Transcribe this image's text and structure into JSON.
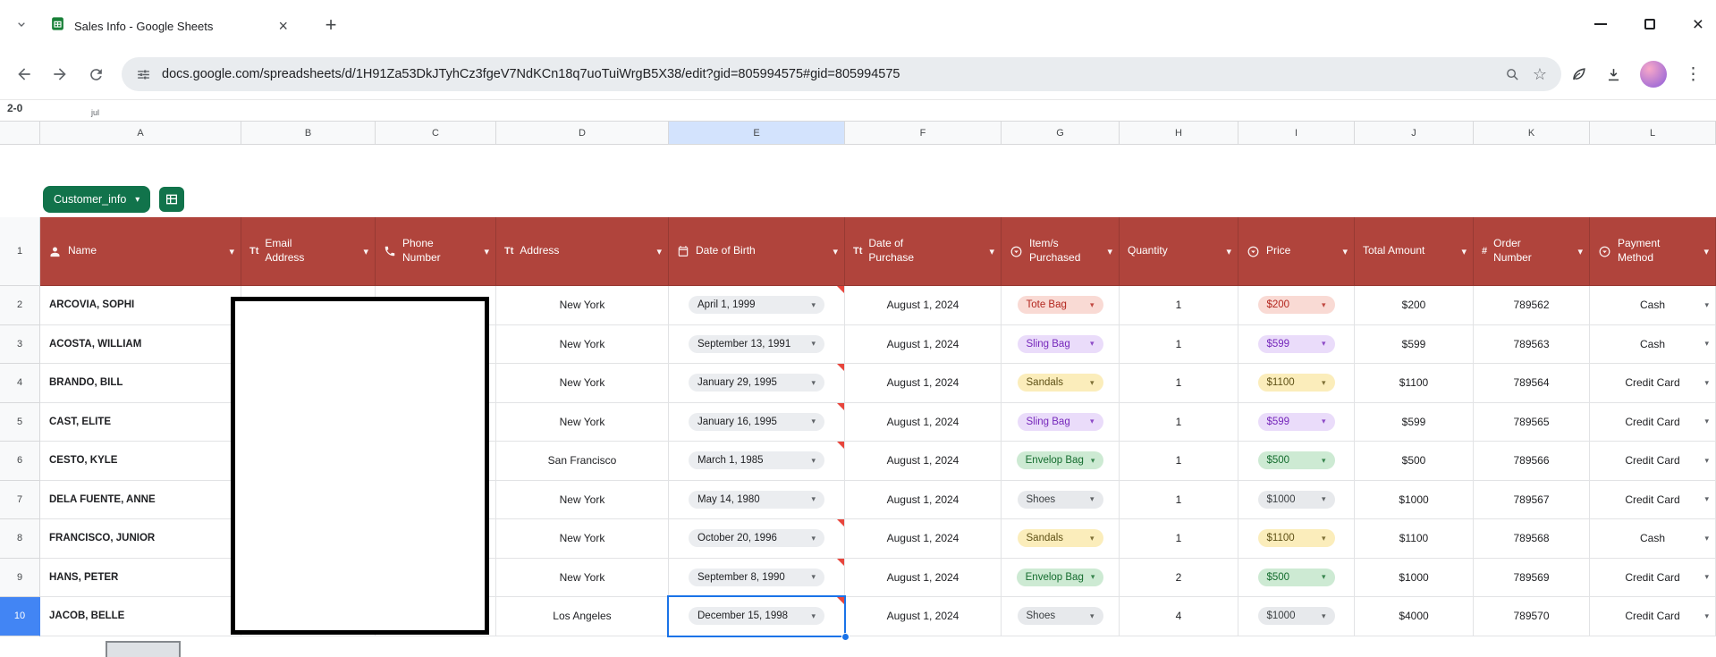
{
  "browser": {
    "tab_title": "Sales Info - Google Sheets",
    "url": "docs.google.com/spreadsheets/d/1H91Za53DkJTyhCz3fgeV7NdKCn18q7uoTuiWrgB5X38/edit?gid=805994575#gid=805994575"
  },
  "icons": {
    "new_tab": "+",
    "close": "×",
    "minimize": "—",
    "menu_dots": "⋮",
    "chevron_down": "▾",
    "star": "☆"
  },
  "colors": {
    "header_red": "#B0443C",
    "table_chip_green": "#11734B",
    "selection_blue": "#1A73E8",
    "selected_row_header": "#4285F4",
    "selected_col_header": "#D3E3FD",
    "flag_red": "#E8453C"
  },
  "sheet": {
    "table_name": "Customer_info",
    "formula_fragments": {
      "left": "2-0",
      "mid": "jul"
    },
    "column_letters": [
      "A",
      "B",
      "C",
      "D",
      "E",
      "F",
      "G",
      "H",
      "I",
      "J",
      "K",
      "L"
    ],
    "selected_column": "E",
    "selected_row": 10,
    "selected_cell": "E10",
    "headers": [
      {
        "col": "A",
        "label": "Name",
        "icon": "person-icon"
      },
      {
        "col": "B",
        "label": "Email Address",
        "icon": "text-icon"
      },
      {
        "col": "C",
        "label": "Phone Number",
        "icon": "phone-icon"
      },
      {
        "col": "D",
        "label": "Address",
        "icon": "text-icon"
      },
      {
        "col": "E",
        "label": "Date of Birth",
        "icon": "calendar-icon"
      },
      {
        "col": "F",
        "label": "Date of Purchase",
        "icon": "text-icon"
      },
      {
        "col": "G",
        "label": "Item/s Purchased",
        "icon": "dropdown-icon"
      },
      {
        "col": "H",
        "label": "Quantity",
        "icon": "none"
      },
      {
        "col": "I",
        "label": "Price",
        "icon": "dropdown-icon"
      },
      {
        "col": "J",
        "label": "Total Amount",
        "icon": "none"
      },
      {
        "col": "K",
        "label": "Order Number",
        "icon": "hash-icon"
      },
      {
        "col": "L",
        "label": "Payment Method",
        "icon": "dropdown-icon"
      }
    ],
    "chip_colors": {
      "red": {
        "bg": "#F9DAD4",
        "fg": "#B3261E"
      },
      "purple": {
        "bg": "#EADCFA",
        "fg": "#7627BB"
      },
      "yellow": {
        "bg": "#FBEDBB",
        "fg": "#5F5116"
      },
      "green": {
        "bg": "#CDEAD3",
        "fg": "#146C2E"
      },
      "gray": {
        "bg": "#E7E9EC",
        "fg": "#3C4043"
      },
      "date": {
        "bg": "#EBEDF0",
        "fg": "#202124"
      }
    },
    "rows": [
      {
        "row": 2,
        "name": "ARCOVIA, SOPHI",
        "address": "New York",
        "dob": "April 1, 1999",
        "dob_flag": true,
        "purchase_date": "August 1, 2024",
        "item": "Tote Bag",
        "item_color": "red",
        "quantity": "1",
        "price": "$200",
        "price_color": "red",
        "total": "$200",
        "order": "789562",
        "payment": "Cash"
      },
      {
        "row": 3,
        "name": "ACOSTA, WILLIAM",
        "address": "New York",
        "dob": "September 13, 1991",
        "dob_flag": false,
        "purchase_date": "August 1, 2024",
        "item": "Sling Bag",
        "item_color": "purple",
        "quantity": "1",
        "price": "$599",
        "price_color": "purple",
        "total": "$599",
        "order": "789563",
        "payment": "Cash"
      },
      {
        "row": 4,
        "name": "BRANDO, BILL",
        "address": "New York",
        "dob": "January 29, 1995",
        "dob_flag": true,
        "purchase_date": "August 1, 2024",
        "item": "Sandals",
        "item_color": "yellow",
        "quantity": "1",
        "price": "$1100",
        "price_color": "yellow",
        "total": "$1100",
        "order": "789564",
        "payment": "Credit Card"
      },
      {
        "row": 5,
        "name": "CAST, ELITE",
        "address": "New York",
        "dob": "January 16, 1995",
        "dob_flag": true,
        "purchase_date": "August 1, 2024",
        "item": "Sling Bag",
        "item_color": "purple",
        "quantity": "1",
        "price": "$599",
        "price_color": "purple",
        "total": "$599",
        "order": "789565",
        "payment": "Credit Card"
      },
      {
        "row": 6,
        "name": "CESTO, KYLE",
        "address": "San Francisco",
        "dob": "March 1, 1985",
        "dob_flag": true,
        "purchase_date": "August 1, 2024",
        "item": "Envelop Bag",
        "item_color": "green",
        "quantity": "1",
        "price": "$500",
        "price_color": "green",
        "total": "$500",
        "order": "789566",
        "payment": "Credit Card"
      },
      {
        "row": 7,
        "name": "DELA FUENTE, ANNE",
        "address": "New York",
        "dob": "May 14, 1980",
        "dob_flag": false,
        "purchase_date": "August 1, 2024",
        "item": "Shoes",
        "item_color": "gray",
        "quantity": "1",
        "price": "$1000",
        "price_color": "gray",
        "total": "$1000",
        "order": "789567",
        "payment": "Credit Card"
      },
      {
        "row": 8,
        "name": "FRANCISCO, JUNIOR",
        "address": "New York",
        "dob": "October 20, 1996",
        "dob_flag": true,
        "purchase_date": "August 1, 2024",
        "item": "Sandals",
        "item_color": "yellow",
        "quantity": "1",
        "price": "$1100",
        "price_color": "yellow",
        "total": "$1100",
        "order": "789568",
        "payment": "Cash"
      },
      {
        "row": 9,
        "name": "HANS, PETER",
        "address": "New York",
        "dob": "September 8, 1990",
        "dob_flag": true,
        "purchase_date": "August 1, 2024",
        "item": "Envelop Bag",
        "item_color": "green",
        "quantity": "2",
        "price": "$500",
        "price_color": "green",
        "total": "$1000",
        "order": "789569",
        "payment": "Credit Card"
      },
      {
        "row": 10,
        "name": "JACOB, BELLE",
        "address": "Los Angeles",
        "dob": "December 15, 1998",
        "dob_flag": true,
        "purchase_date": "August 1, 2024",
        "item": "Shoes",
        "item_color": "gray",
        "quantity": "4",
        "price": "$1000",
        "price_color": "gray",
        "total": "$4000",
        "order": "789570",
        "payment": "Credit Card"
      }
    ]
  }
}
